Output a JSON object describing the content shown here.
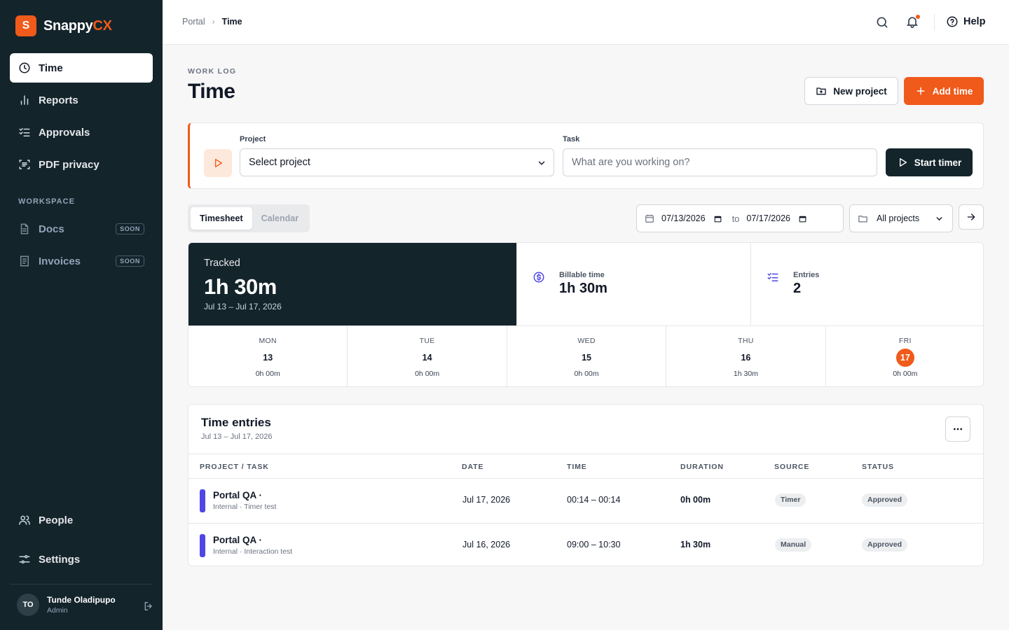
{
  "brand": {
    "mark": "S",
    "name_a": "Snappy",
    "name_b": "CX",
    "accent": "#f05a1a"
  },
  "sidebar": {
    "items": [
      {
        "label": "Time",
        "icon": "clock-icon"
      },
      {
        "label": "Reports",
        "icon": "bar-chart-icon"
      },
      {
        "label": "Approvals",
        "icon": "checklist-icon"
      },
      {
        "label": "PDF privacy",
        "icon": "scan-text-icon"
      }
    ],
    "workspace_label": "WORKSPACE",
    "workspace_items": [
      {
        "label": "Docs",
        "badge": "SOON",
        "icon": "document-icon"
      },
      {
        "label": "Invoices",
        "badge": "SOON",
        "icon": "invoice-icon"
      }
    ],
    "bottom_items": [
      {
        "label": "People",
        "icon": "users-icon"
      },
      {
        "label": "Settings",
        "icon": "sliders-icon"
      }
    ],
    "user": {
      "initials": "TO",
      "name": "Tunde Oladipupo",
      "role": "Admin"
    }
  },
  "topbar": {
    "breadcrumb": [
      "Portal",
      "Time"
    ],
    "breadcrumb_sep": "›",
    "help_label": "Help"
  },
  "header": {
    "eyebrow": "WORK LOG",
    "title": "Time",
    "new_project_label": "New project",
    "add_time_label": "Add time"
  },
  "timer": {
    "project_label": "Project",
    "project_value": "Select project",
    "task_label": "Task",
    "task_placeholder": "What are you working on?",
    "start_label": "Start timer"
  },
  "view_tabs": [
    "Timesheet",
    "Calendar"
  ],
  "filters": {
    "from_date": "07/13/2026",
    "to_label": "to",
    "to_date": "07/17/2026",
    "project_filter": "All projects"
  },
  "summary": {
    "tracked_label": "Tracked",
    "tracked_value": "1h 30m",
    "tracked_range": "Jul 13 – Jul 17, 2026",
    "billable_label": "Billable time",
    "billable_value": "1h 30m",
    "entries_label": "Entries",
    "entries_value": "2"
  },
  "days": [
    {
      "name": "MON",
      "num": "13",
      "hours": "0h 00m",
      "today": false
    },
    {
      "name": "TUE",
      "num": "14",
      "hours": "0h 00m",
      "today": false
    },
    {
      "name": "WED",
      "num": "15",
      "hours": "0h 00m",
      "today": false
    },
    {
      "name": "THU",
      "num": "16",
      "hours": "1h 30m",
      "today": false
    },
    {
      "name": "FRI",
      "num": "17",
      "hours": "0h 00m",
      "today": true
    }
  ],
  "entries": {
    "title": "Time entries",
    "subtitle": "Jul 13 – Jul 17, 2026",
    "columns": [
      "PROJECT / TASK",
      "DATE",
      "TIME",
      "DURATION",
      "SOURCE",
      "STATUS"
    ],
    "rows": [
      {
        "project": "Portal QA ·",
        "detail": "Internal · Timer test",
        "date": "Jul 17, 2026",
        "time": "00:14 – 00:14",
        "duration": "0h 00m",
        "source": "Timer",
        "status": "Approved",
        "color": "#4f46e5"
      },
      {
        "project": "Portal QA ·",
        "detail": "Internal · Interaction test",
        "date": "Jul 16, 2026",
        "time": "09:00 – 10:30",
        "duration": "1h 30m",
        "source": "Manual",
        "status": "Approved",
        "color": "#4f46e5"
      }
    ]
  }
}
